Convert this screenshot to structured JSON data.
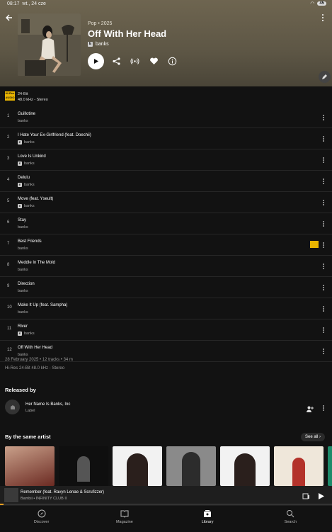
{
  "status": {
    "time": "08:17",
    "date": "wt., 24 cze",
    "battery": "45"
  },
  "album": {
    "genre_year": "Pop • 2025",
    "title": "Off With Her Head",
    "explicit": "E",
    "artist": "banks"
  },
  "quality": {
    "badge_top": "Hi-Res",
    "badge_bottom": "AUDIO",
    "bits": "24-Bit",
    "detail": "48.0 kHz - Stereo"
  },
  "tracks": [
    {
      "num": "1",
      "name": "Guillotine",
      "artist": "banks",
      "explicit": false
    },
    {
      "num": "2",
      "name": "I Hate Your Ex-Girlfriend (feat. Doechii)",
      "artist": "banks",
      "explicit": true
    },
    {
      "num": "3",
      "name": "Love Is Unkind",
      "artist": "banks",
      "explicit": true
    },
    {
      "num": "4",
      "name": "Delulu",
      "artist": "banks",
      "explicit": true
    },
    {
      "num": "5",
      "name": "Move (feat. Yseult)",
      "artist": "banks",
      "explicit": true
    },
    {
      "num": "6",
      "name": "Stay",
      "artist": "banks",
      "explicit": false
    },
    {
      "num": "7",
      "name": "Best Friends",
      "artist": "banks",
      "explicit": false,
      "hires": true
    },
    {
      "num": "8",
      "name": "Meddle In The Mold",
      "artist": "banks",
      "explicit": false
    },
    {
      "num": "9",
      "name": "Direction",
      "artist": "banks",
      "explicit": false
    },
    {
      "num": "10",
      "name": "Make It Up (feat. Sampha)",
      "artist": "banks",
      "explicit": false
    },
    {
      "num": "11",
      "name": "River",
      "artist": "banks",
      "explicit": true
    },
    {
      "num": "12",
      "name": "Off With Her Head",
      "artist": "banks",
      "explicit": false
    }
  ],
  "meta": {
    "summary": "28 February 2025 • 12 tracks • 34 m",
    "format": "Hi-Res 24-Bit 48.0 kHz - Stereo"
  },
  "released_by": {
    "title": "Released by",
    "label_name": "Her Name Is Banks, Inc",
    "label_role": "Label"
  },
  "same_artist": {
    "title": "By the same artist",
    "see_all": "See all"
  },
  "mini_player": {
    "title": "Remember (feat. Ravyn Lenae & Scrufizzer)",
    "subtitle": "Bambii • INFINITY CLUB II",
    "progress": 0.01
  },
  "nav": [
    {
      "label": "Discover",
      "icon": "compass-icon",
      "active": false
    },
    {
      "label": "Magazine",
      "icon": "book-icon",
      "active": false
    },
    {
      "label": "Library",
      "icon": "library-icon",
      "active": true
    },
    {
      "label": "Search",
      "icon": "search-icon",
      "active": false
    }
  ],
  "colors": {
    "accent": "#e8b400",
    "header_bg": "#6e6550",
    "bg": "#121212"
  }
}
